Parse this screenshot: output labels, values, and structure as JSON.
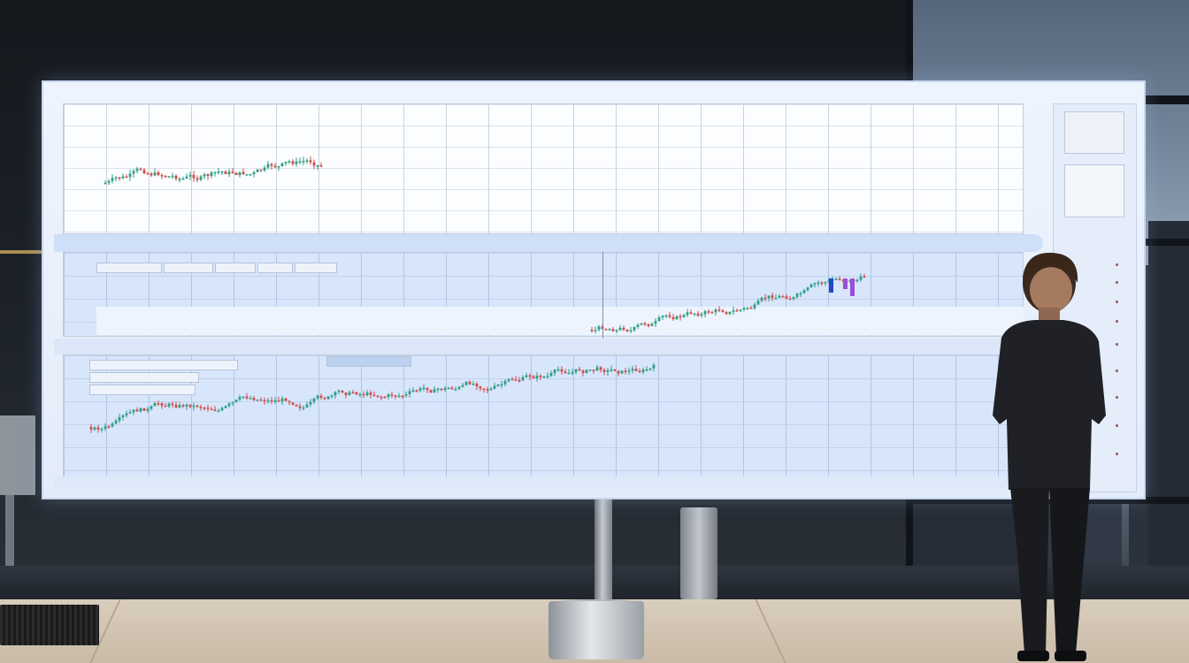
{
  "colors": {
    "screen_bg": "#eaf1fc",
    "candle_up": "#2e9e86",
    "candle_down": "#d24a4a",
    "accent_blue": "#2747c9",
    "accent_purple": "#9b4fd6",
    "suit": "#1d1f24"
  },
  "scene": {
    "screen": {
      "header": {
        "left": "",
        "center": "",
        "right": ""
      },
      "panels": [
        {
          "title": "",
          "series": "top-chart"
        },
        {
          "title": "",
          "series": "middle-chart"
        },
        {
          "title": "",
          "series": "bottom-chart"
        }
      ],
      "sidebar": {
        "icon": "list-icon"
      }
    },
    "person": {
      "icon": "person-silhouette"
    }
  }
}
